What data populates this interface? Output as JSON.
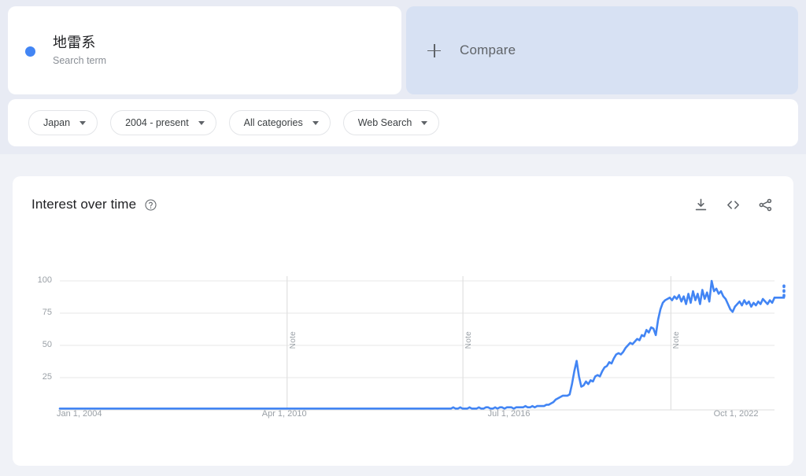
{
  "term_card": {
    "title": "地雷系",
    "subtitle": "Search term",
    "dot_color": "#4285f4"
  },
  "compare": {
    "label": "Compare",
    "icon": "plus-icon"
  },
  "filters": [
    {
      "label": "Japan",
      "icon": "chevron-down-icon"
    },
    {
      "label": "2004 - present",
      "icon": "chevron-down-icon"
    },
    {
      "label": "All categories",
      "icon": "chevron-down-icon"
    },
    {
      "label": "Web Search",
      "icon": "chevron-down-icon"
    }
  ],
  "chart_panel": {
    "title": "Interest over time",
    "help_icon": "help-circle-icon",
    "actions": [
      {
        "name": "download-icon",
        "tooltip": "Download"
      },
      {
        "name": "embed-code-icon",
        "tooltip": "Embed"
      },
      {
        "name": "share-icon",
        "tooltip": "Share"
      }
    ]
  },
  "chart_data": {
    "type": "line",
    "title": "Interest over time",
    "xlabel": "",
    "ylabel": "",
    "ylim": [
      0,
      100
    ],
    "yticks": [
      25,
      50,
      75,
      100
    ],
    "grid": true,
    "legend_position": "none",
    "line_color": "#4285f4",
    "xtick_labels": [
      "Jan 1, 2004",
      "Apr 1, 2010",
      "Jul 1, 2016",
      "Oct 1, 2022"
    ],
    "xtick_positions": [
      0,
      31.8,
      63.4,
      95.0
    ],
    "annotations": [
      {
        "label": "Note",
        "x_pct": 31.8
      },
      {
        "label": "Note",
        "x_pct": 56.4
      },
      {
        "label": "Note",
        "x_pct": 85.5
      }
    ],
    "partial_data_tail": {
      "label": "partial data",
      "x_pct": 100,
      "style": "dotted"
    },
    "series": [
      {
        "name": "地雷系",
        "values": [
          1,
          1,
          1,
          1,
          1,
          1,
          1,
          1,
          1,
          1,
          1,
          1,
          1,
          1,
          1,
          1,
          1,
          1,
          1,
          1,
          1,
          1,
          1,
          1,
          1,
          1,
          1,
          1,
          1,
          1,
          1,
          1,
          1,
          1,
          1,
          1,
          1,
          1,
          1,
          1,
          1,
          1,
          1,
          1,
          1,
          1,
          1,
          1,
          1,
          1,
          1,
          1,
          1,
          1,
          1,
          1,
          1,
          1,
          1,
          1,
          1,
          1,
          1,
          1,
          1,
          1,
          1,
          1,
          1,
          1,
          1,
          1,
          1,
          1,
          1,
          1,
          1,
          1,
          1,
          1,
          1,
          1,
          1,
          1,
          1,
          1,
          1,
          1,
          1,
          1,
          1,
          1,
          1,
          1,
          1,
          1,
          1,
          1,
          1,
          1,
          1,
          1,
          1,
          1,
          1,
          1,
          1,
          1,
          1,
          1,
          1,
          1,
          1,
          1,
          1,
          1,
          1,
          1,
          1,
          1,
          1,
          1,
          1,
          1,
          1,
          1,
          1,
          1,
          1,
          1,
          1,
          1,
          1,
          1,
          1,
          1,
          1,
          1,
          1,
          1,
          1,
          1,
          1,
          1,
          1,
          1,
          1,
          1,
          1,
          1,
          1,
          1,
          1,
          1,
          1,
          1,
          1,
          1,
          1,
          1,
          1,
          1,
          1,
          1,
          1,
          1,
          1,
          1,
          1,
          2,
          1,
          1,
          2,
          1,
          1,
          1,
          2,
          1,
          1,
          1,
          2,
          1,
          1,
          2,
          2,
          1,
          1,
          2,
          1,
          2,
          2,
          1,
          2,
          2,
          2,
          1,
          2,
          2,
          2,
          2,
          3,
          2,
          2,
          3,
          2,
          3,
          3,
          3,
          3,
          4,
          4,
          5,
          6,
          8,
          9,
          10,
          11,
          11,
          11,
          12,
          20,
          30,
          38,
          26,
          18,
          19,
          22,
          20,
          23,
          22,
          26,
          27,
          26,
          30,
          33,
          34,
          37,
          36,
          40,
          43,
          44,
          43,
          45,
          48,
          50,
          52,
          51,
          53,
          55,
          54,
          58,
          57,
          62,
          60,
          64,
          63,
          58,
          70,
          78,
          83,
          85,
          86,
          87,
          85,
          88,
          86,
          89,
          84,
          88,
          82,
          90,
          83,
          92,
          85,
          90,
          82,
          93,
          86,
          91,
          84,
          100,
          92,
          94,
          90,
          92,
          88,
          86,
          82,
          78,
          76,
          80,
          82,
          84,
          81,
          85,
          82,
          84,
          80,
          83,
          81,
          84,
          82,
          86,
          84,
          82,
          85,
          83,
          87
        ],
        "start": "2004-01-01",
        "end": "2025-02-01",
        "interval": "monthly"
      }
    ]
  }
}
